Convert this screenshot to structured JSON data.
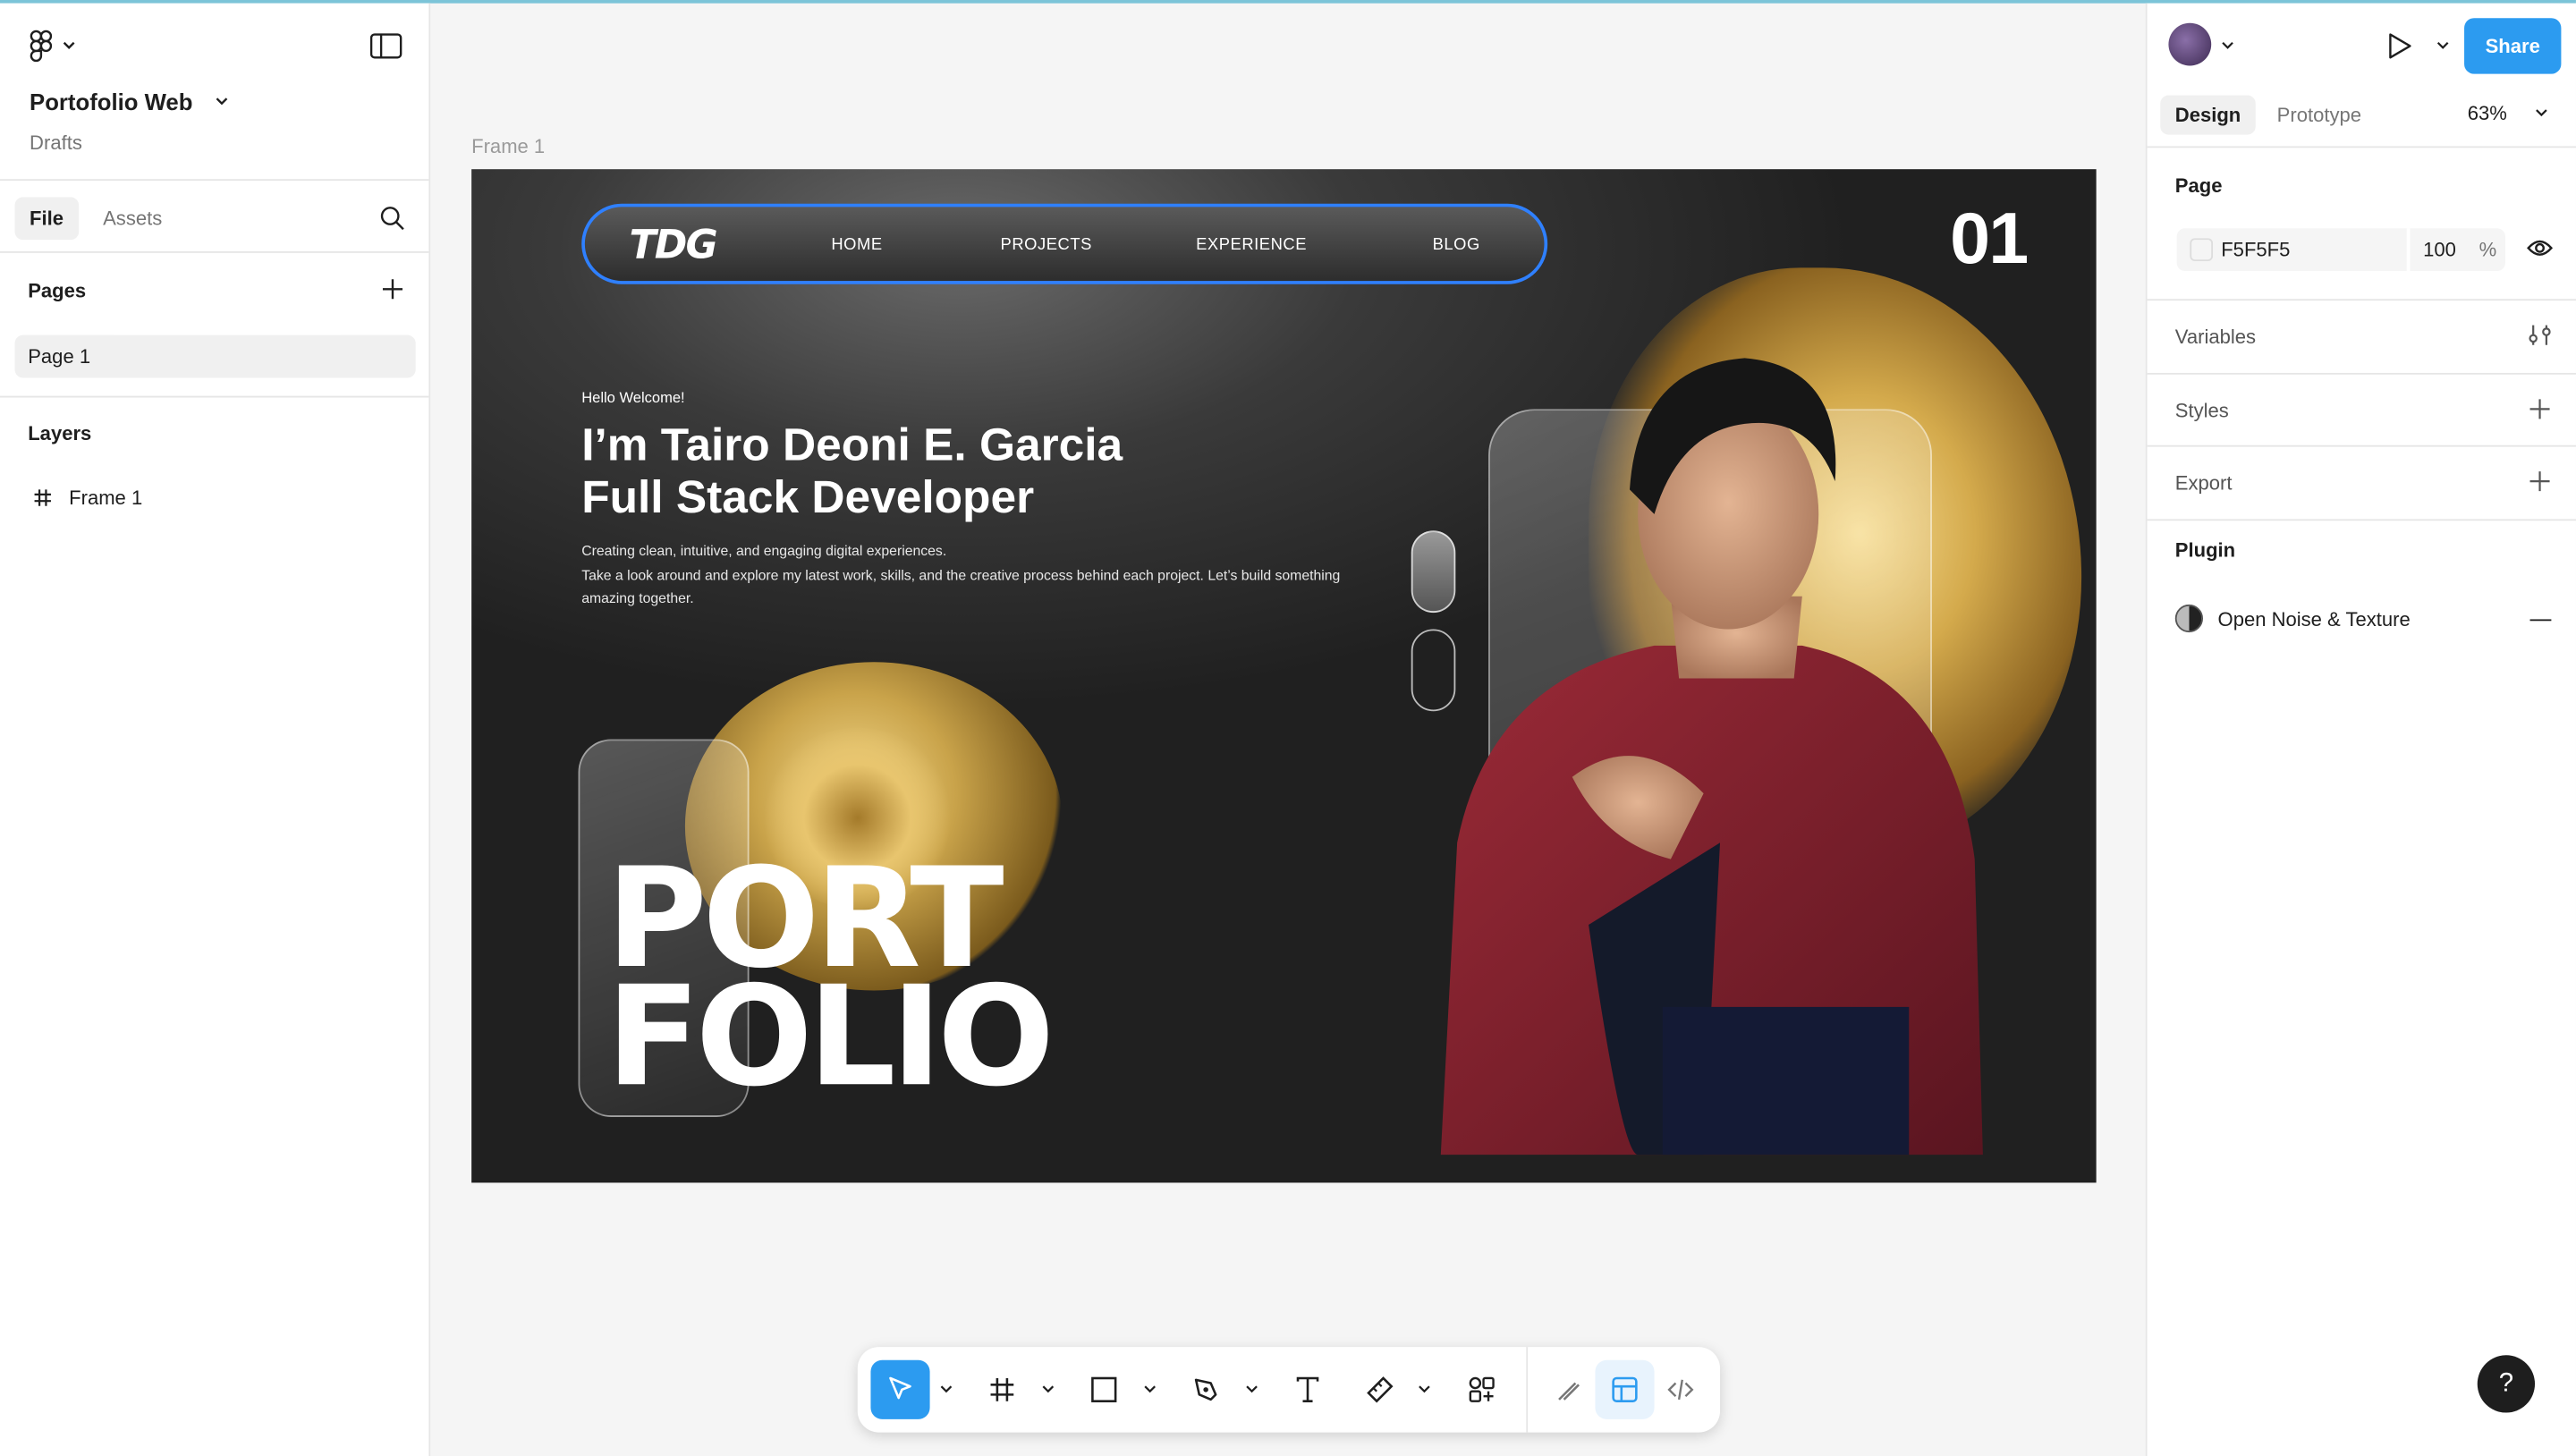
{
  "app": {
    "project_title": "Portofolio Web",
    "project_location": "Drafts",
    "left_tabs": [
      "File",
      "Assets"
    ],
    "pages_title": "Pages",
    "pages": [
      "Page 1"
    ],
    "layers_title": "Layers",
    "layers": [
      "Frame 1"
    ]
  },
  "right_panel": {
    "share_label": "Share",
    "tabs": [
      "Design",
      "Prototype"
    ],
    "zoom": "63%",
    "page_section": "Page",
    "page_color": "F5F5F5",
    "page_opacity": "100",
    "opacity_unit": "%",
    "variables": "Variables",
    "styles": "Styles",
    "export": "Export",
    "plugin_title": "Plugin",
    "plugin_name": "Open Noise & Texture",
    "help": "?"
  },
  "canvas": {
    "frame_label": "Frame 1",
    "design": {
      "logo": "TDG",
      "nav": [
        "HOME",
        "PROJECTS",
        "EXPERIENCE",
        "BLOG"
      ],
      "page_number": "01",
      "hello": "Hello Welcome!",
      "title_line1": "I’m Tairo Deoni E. Garcia",
      "title_line2": "Full Stack Developer",
      "desc_line1": "Creating clean, intuitive, and engaging digital experiences.",
      "desc_line2": "Take a look around and explore my latest work, skills, and the creative process behind each project. Let’s build something amazing together.",
      "big_line1": "PORT",
      "big_line2": "FOLIO"
    }
  },
  "colors": {
    "accent": "#2c9bf0",
    "nav_border": "#2f80ff",
    "gold": "#c9a34a",
    "shirt": "#7a1f2b"
  }
}
